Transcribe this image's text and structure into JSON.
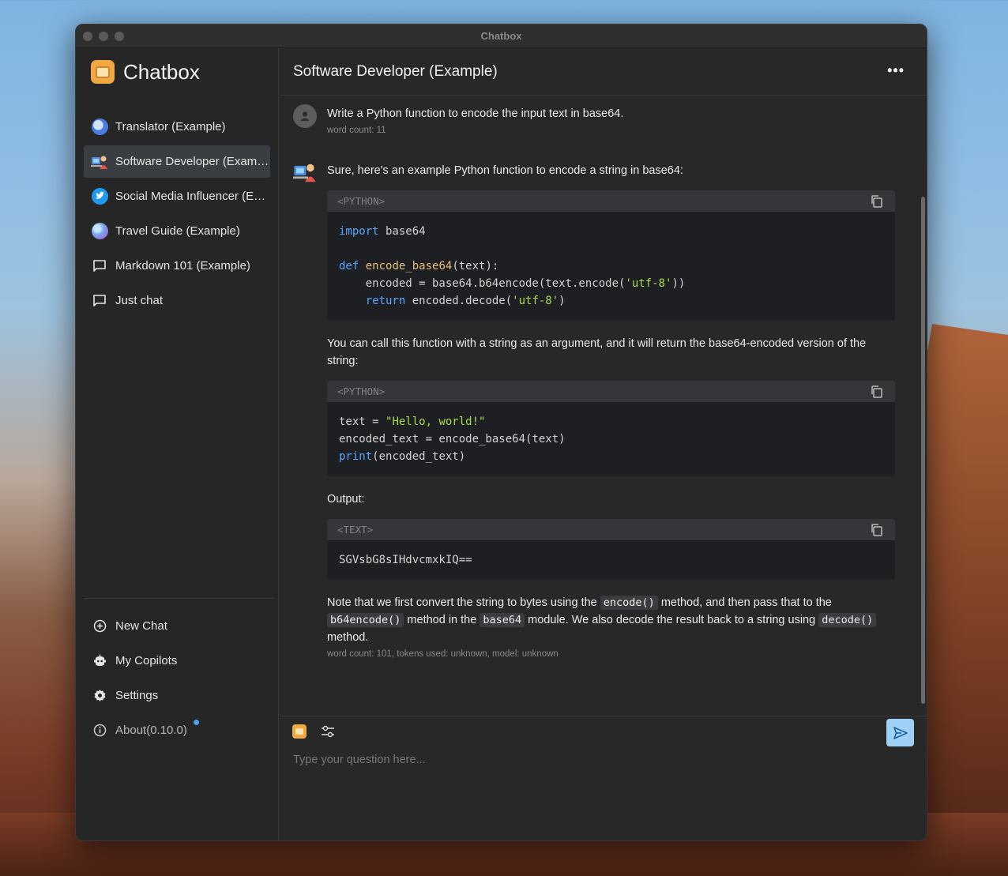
{
  "window": {
    "title": "Chatbox"
  },
  "brand": {
    "name": "Chatbox"
  },
  "chats": [
    {
      "label": "Translator (Example)",
      "icon": "translator-avatar-icon",
      "active": false
    },
    {
      "label": "Software Developer (Exam…",
      "icon": "developer-avatar-icon",
      "active": true
    },
    {
      "label": "Social Media Influencer (E…",
      "icon": "twitter-bird-icon",
      "active": false
    },
    {
      "label": "Travel Guide (Example)",
      "icon": "globe-avatar-icon",
      "active": false
    },
    {
      "label": "Markdown 101 (Example)",
      "icon": "chat-bubble-icon",
      "active": false
    },
    {
      "label": "Just chat",
      "icon": "chat-bubble-icon",
      "active": false
    }
  ],
  "menu": {
    "new_chat": "New Chat",
    "my_copilots": "My Copilots",
    "settings": "Settings",
    "about": "About(0.10.0)"
  },
  "header": {
    "title": "Software Developer (Example)",
    "more": "•••"
  },
  "user_message": {
    "text": "Write a Python function to encode the input text in base64.",
    "meta": "word count: 11"
  },
  "assistant_message": {
    "intro": "Sure, here's an example Python function to encode a string in base64:",
    "code1_lang": "<PYTHON>",
    "code1_line1_kw": "import",
    "code1_line1_rest": " base64",
    "code1_line3_kw": "def",
    "code1_line3_fn": "encode_base64",
    "code1_line3_rest": "(text):",
    "code1_line4_a": "    encoded = base64.b64encode(text.encode(",
    "code1_line4_str": "'utf-8'",
    "code1_line4_b": "))",
    "code1_line5_kw": "return",
    "code1_line5_a": " encoded.decode(",
    "code1_line5_str": "'utf-8'",
    "code1_line5_b": ")",
    "para2": "You can call this function with a string as an argument, and it will return the base64-encoded version of the string:",
    "code2_lang": "<PYTHON>",
    "code2_line1_a": "text = ",
    "code2_line1_str": "\"Hello, world!\"",
    "code2_line2": "encoded_text = encode_base64(text)",
    "code2_line3_kw": "print",
    "code2_line3_rest": "(encoded_text)",
    "output_label": "Output:",
    "code3_lang": "<TEXT>",
    "code3_body": "SGVsbG8sIHdvcmxkIQ==",
    "note_1": "Note that we first convert the string to bytes using the ",
    "note_code_1": "encode()",
    "note_2": " method, and then pass that to the ",
    "note_code_2": "b64encode()",
    "note_3": " method in the ",
    "note_code_3": "base64",
    "note_4": " module. We also decode the result back to a string using ",
    "note_code_4": "decode()",
    "note_5": " method.",
    "meta": "word count: 101, tokens used: unknown, model: unknown"
  },
  "composer": {
    "placeholder": "Type your question here..."
  },
  "colors": {
    "accent": "#9fd0f6",
    "keyword": "#57a6ff",
    "function": "#e6c07b",
    "string": "#a8dc4c"
  }
}
